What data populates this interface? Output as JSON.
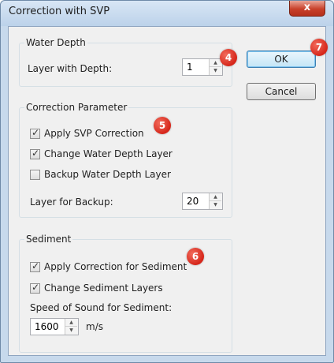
{
  "window": {
    "title": "Correction with SVP",
    "close_label": "x"
  },
  "water_depth": {
    "legend": "Water Depth",
    "layer_label": "Layer with Depth:",
    "layer_value": "1"
  },
  "correction": {
    "legend": "Correction Parameter",
    "apply_svp": {
      "label": "Apply SVP Correction",
      "checked": true
    },
    "change_layer": {
      "label": "Change Water Depth Layer",
      "checked": true
    },
    "backup_layer": {
      "label": "Backup Water Depth Layer",
      "checked": false
    },
    "backup_label": "Layer for Backup:",
    "backup_value": "20"
  },
  "sediment": {
    "legend": "Sediment",
    "apply_sediment": {
      "label": "Apply Correction for Sediment",
      "checked": true
    },
    "change_sediment": {
      "label": "Change Sediment Layers",
      "checked": true
    },
    "speed_label": "Speed of Sound for Sediment:",
    "speed_value": "1600",
    "speed_unit": "m/s"
  },
  "buttons": {
    "ok": "OK",
    "cancel": "Cancel"
  },
  "annotations": [
    "4",
    "5",
    "6",
    "7"
  ],
  "colors": {
    "badge": "#d6261a",
    "close": "#c8402a",
    "frame": "#c7d9ec"
  },
  "icons": {
    "close": "close-icon",
    "spin_up": "arrow-up-icon",
    "spin_down": "arrow-down-icon",
    "check": "checkmark-icon"
  }
}
